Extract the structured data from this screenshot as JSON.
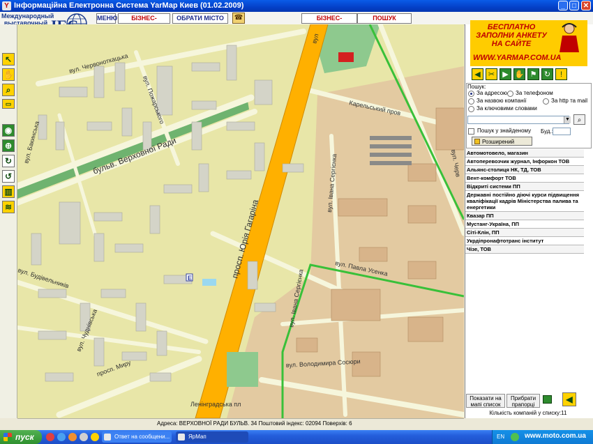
{
  "window": {
    "title": "Інформаційна Електронна Система YarMap Киев (01.02.2009)",
    "icon_letter": "Y",
    "minimize": "_",
    "maximize": "□",
    "close": "✕"
  },
  "header": {
    "logo_text": "Международный выставочный центр",
    "logo_abbr": "IEC",
    "menu_label": "МЕНЮ",
    "notebook_label": "БІЗНЕС-БЛОКНОТ",
    "city_label": "ОБРАТИ МІСТО",
    "catalog_label": "БІЗНЕС-КАТАЛОГ",
    "search_label": "ПОШУК"
  },
  "map": {
    "streets": {
      "chervonotkatska": "вул. Червоноткацька",
      "pozharskogo": "вул. Пожарського",
      "bakinska": "вул. Бакинська",
      "verkhovnoi_rady": "бульв. Верховної Ради",
      "karelskyi": "Карельський пров",
      "ivana_sergienka_1": "вул. Івана Сергієнка",
      "ivana_sergienka_2": "вул. Івана Сергієнка",
      "gagarina": "просп. Юрія Гагаріна",
      "pavla_usenka": "вул. Павла Усенка",
      "budivelnykiv": "вул. Будівельників",
      "chudnivska": "вул. Чуднівська",
      "myru": "просп. Миру",
      "sosiury": "вул. Володимира Сосюри",
      "leningradska": "Ленінградська пл",
      "top_vul": "вул",
      "right_vul": "вул. Черв"
    },
    "marker_letter": "E"
  },
  "banner": {
    "line1": "БЕСПЛАТНО ЗАПОЛНИ АНКЕТУ НА САЙТЕ",
    "line2": "WWW.YARMAP.COM.UA"
  },
  "search": {
    "title": "Пошук:",
    "opt_address": "За адресою",
    "opt_phone": "За телефоном",
    "opt_company": "За назвою компанії",
    "opt_http": "За http та mail",
    "opt_keywords": "За ключовими словами",
    "selected": "За адресою",
    "input_value": "",
    "in_found_label": "Пошук у знайденому",
    "bud_label": "Буд.:",
    "bud_value": "",
    "advanced_button": "Розширений пошук",
    "go_icon": "magnifier-icon"
  },
  "results": [
    "Автомотовело, магазин",
    "Автоперевозчик журнал, Інфоркон ТОВ",
    "Альянс-столиця НК, ТД, ТОВ",
    "Вент-комфорт ТОВ",
    "Відкриті системи ПП",
    "Державні постійно діючі курси підвищення кваліфікації кадрів Міністерства палива та енергетики",
    "Квазар ПП",
    "Мустанг-Україна, ПП",
    "Сіті-Клін, ПП",
    "Укрдіпронафтотранс інститут",
    "Чізе, ТОВ"
  ],
  "bottom": {
    "show_on_map": "Показати на мапі список",
    "remove_flags": "Прибрати прапорці",
    "count_text": "Кількість компаній у списку:11"
  },
  "status": {
    "text": "Адреса: ВЕРХОВНОЇ РАДИ БУЛЬВ. 34   Поштовий індекс: 02094  Поверхів: 6"
  },
  "taskbar": {
    "start_label": "пуск",
    "task1": "Ответ на сообщени...",
    "task2": "ЯрМап",
    "lang": "EN",
    "site": "www.moto.com.ua"
  },
  "colors": {
    "map_bg": "#e8e6a8",
    "road": "#f6f6dc",
    "main_road": "#ffb000",
    "green_strip": "#6fb36f",
    "building": "#d4d4c8",
    "industrial": "#e3caa1",
    "route": "#39c039",
    "toolbar_yellow": "#ffd200",
    "toolbar_green": "#2e8b2e",
    "xp_blue": "#245edb"
  }
}
